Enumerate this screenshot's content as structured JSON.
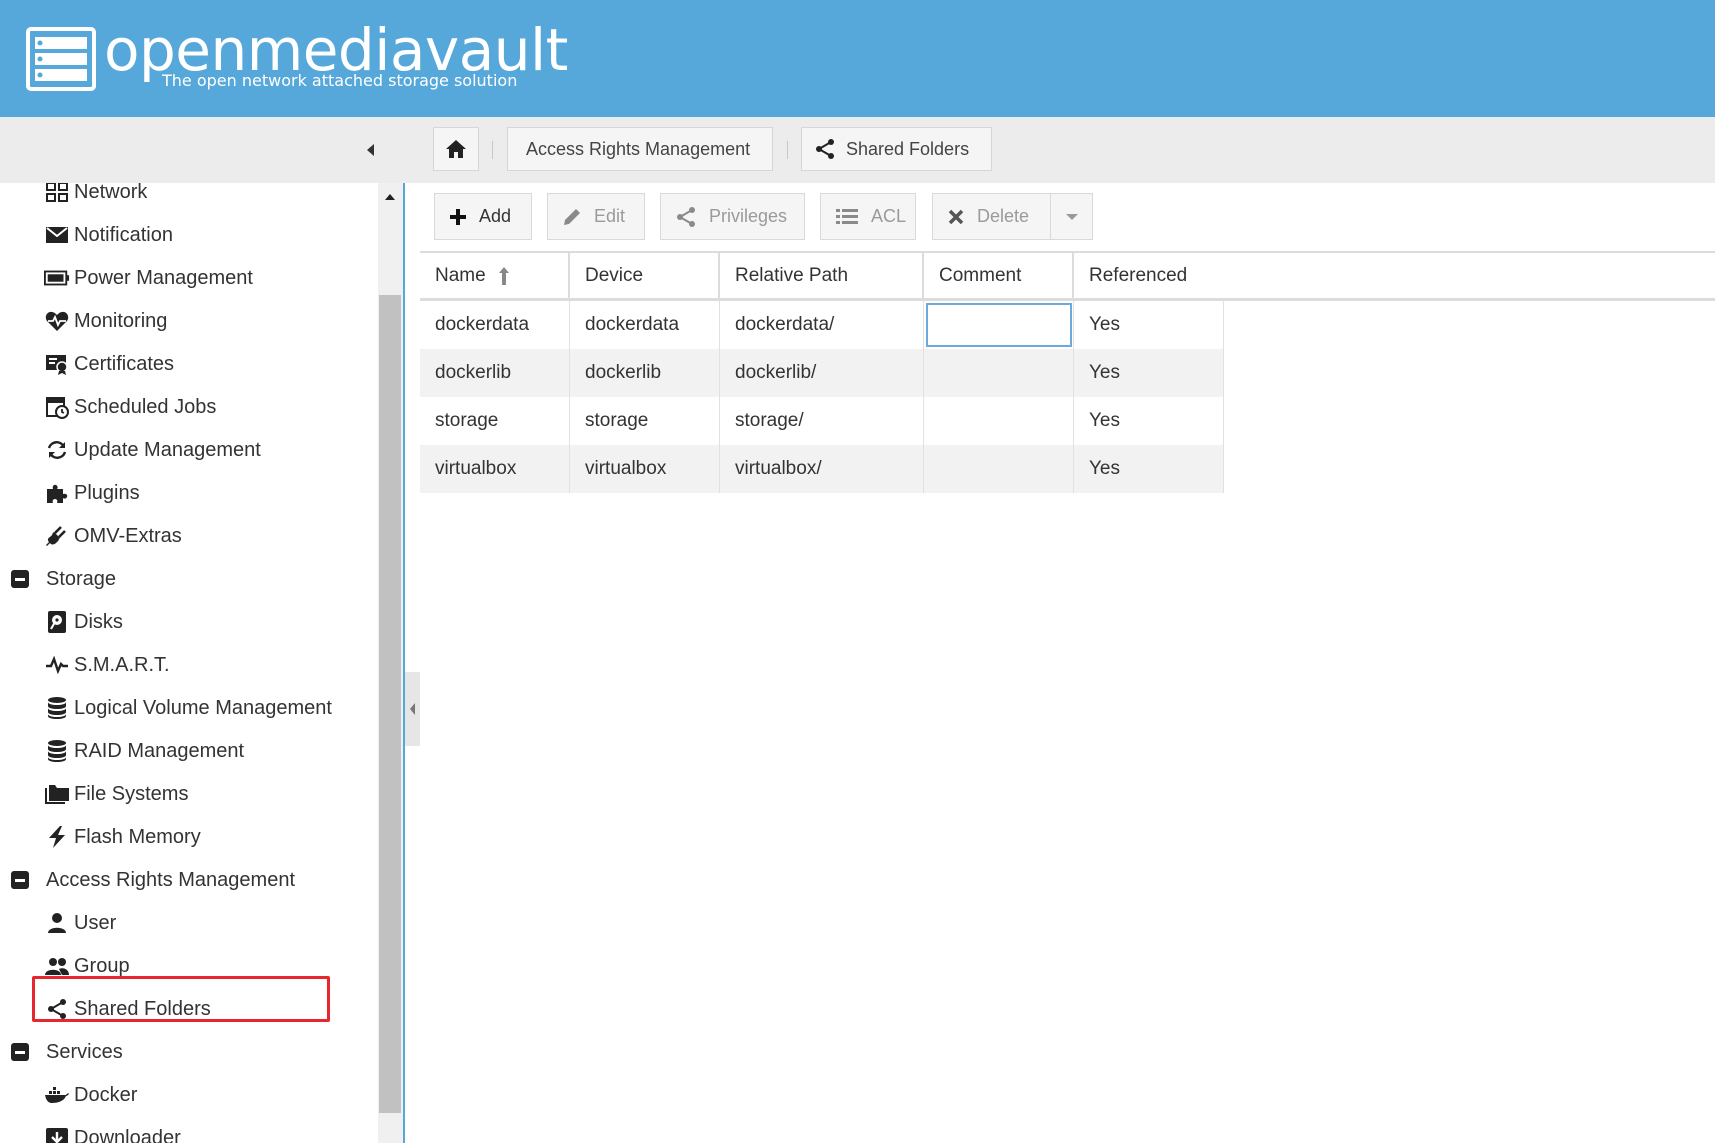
{
  "app": {
    "brand_name": "openmediavault",
    "tagline": "The open network attached storage solution",
    "colors": {
      "header": "#56a8da",
      "highlight": "#e8262d",
      "focus": "#6da9dc"
    }
  },
  "breadcrumb": {
    "home_icon": "home-icon",
    "items": [
      {
        "label": "Access Rights Management"
      },
      {
        "label": "Shared Folders",
        "icon": "share-icon"
      }
    ]
  },
  "sidebar": {
    "items": [
      {
        "label": "Network",
        "icon": "network-icon",
        "level": 2
      },
      {
        "label": "Notification",
        "icon": "envelope-icon",
        "level": 2
      },
      {
        "label": "Power Management",
        "icon": "battery-icon",
        "level": 2
      },
      {
        "label": "Monitoring",
        "icon": "heartbeat-icon",
        "level": 2
      },
      {
        "label": "Certificates",
        "icon": "certificate-icon",
        "level": 2
      },
      {
        "label": "Scheduled Jobs",
        "icon": "calendar-clock-icon",
        "level": 2
      },
      {
        "label": "Update Management",
        "icon": "refresh-icon",
        "level": 2
      },
      {
        "label": "Plugins",
        "icon": "puzzle-icon",
        "level": 2
      },
      {
        "label": "OMV-Extras",
        "icon": "plug-icon",
        "level": 2
      },
      {
        "label": "Storage",
        "icon": "minus-square-icon",
        "level": 1
      },
      {
        "label": "Disks",
        "icon": "harddisk-icon",
        "level": 2
      },
      {
        "label": "S.M.A.R.T.",
        "icon": "pulse-icon",
        "level": 2
      },
      {
        "label": "Logical Volume Management",
        "icon": "database-icon",
        "level": 2
      },
      {
        "label": "RAID Management",
        "icon": "database-icon",
        "level": 2
      },
      {
        "label": "File Systems",
        "icon": "folders-icon",
        "level": 2
      },
      {
        "label": "Flash Memory",
        "icon": "flash-icon",
        "level": 2
      },
      {
        "label": "Access Rights Management",
        "icon": "minus-square-icon",
        "level": 1
      },
      {
        "label": "User",
        "icon": "user-icon",
        "level": 2
      },
      {
        "label": "Group",
        "icon": "group-icon",
        "level": 2
      },
      {
        "label": "Shared Folders",
        "icon": "share-icon",
        "level": 2,
        "selected": true
      },
      {
        "label": "Services",
        "icon": "minus-square-icon",
        "level": 1
      },
      {
        "label": "Docker",
        "icon": "docker-icon",
        "level": 2
      },
      {
        "label": "Downloader",
        "icon": "download-box-icon",
        "level": 2
      }
    ]
  },
  "actions": {
    "add": "Add",
    "edit": "Edit",
    "privileges": "Privileges",
    "acl": "ACL",
    "delete": "Delete"
  },
  "grid": {
    "columns": [
      "Name",
      "Device",
      "Relative Path",
      "Comment",
      "Referenced"
    ],
    "sort_column": "Name",
    "sort_direction": "ascending",
    "rows": [
      {
        "name": "dockerdata",
        "device": "dockerdata",
        "path": "dockerdata/",
        "comment": "",
        "referenced": "Yes"
      },
      {
        "name": "dockerlib",
        "device": "dockerlib",
        "path": "dockerlib/",
        "comment": "",
        "referenced": "Yes"
      },
      {
        "name": "storage",
        "device": "storage",
        "path": "storage/",
        "comment": "",
        "referenced": "Yes"
      },
      {
        "name": "virtualbox",
        "device": "virtualbox",
        "path": "virtualbox/",
        "comment": "",
        "referenced": "Yes"
      }
    ]
  }
}
